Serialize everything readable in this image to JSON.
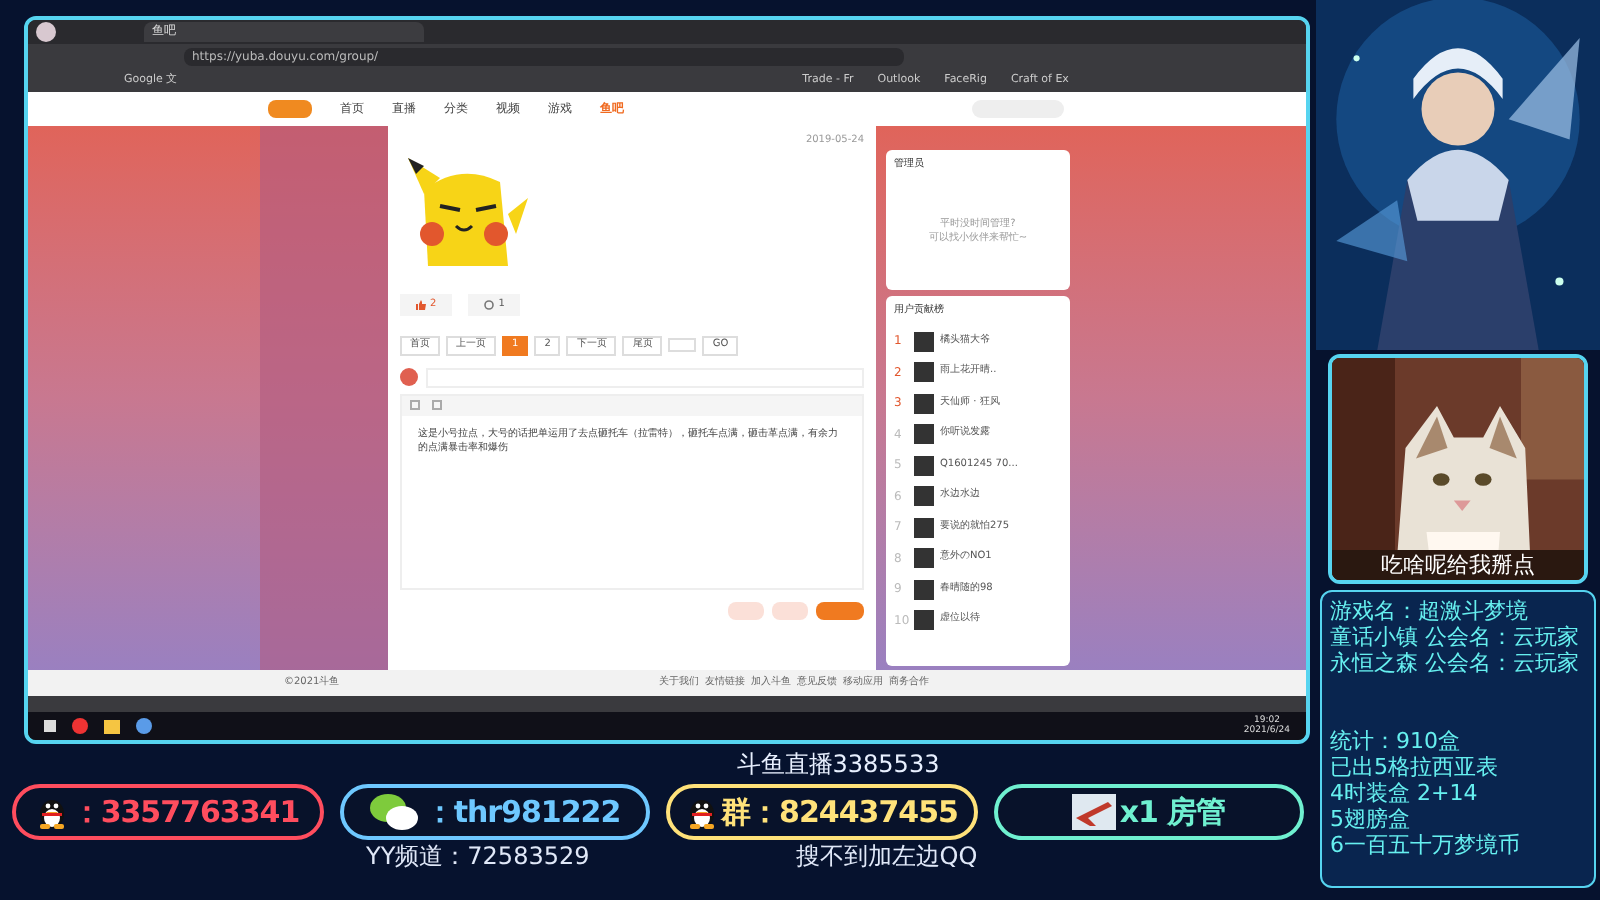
{
  "browser": {
    "tab_title": "鱼吧",
    "url": "https://yuba.douyu.com/group/",
    "bookmarks": [
      "Google 文",
      "Trade - Fr",
      "Outlook",
      "FaceRig",
      "Craft of Ex"
    ]
  },
  "site_nav": [
    {
      "label": "首页",
      "selected": false
    },
    {
      "label": "直播",
      "selected": false
    },
    {
      "label": "分类",
      "selected": false
    },
    {
      "label": "视频",
      "selected": false
    },
    {
      "label": "游戏",
      "selected": false
    },
    {
      "label": "鱼吧",
      "selected": true
    }
  ],
  "post": {
    "date": "2019-05-24",
    "likes": "2",
    "comments": "1"
  },
  "pagination": {
    "first": "首页",
    "prev": "上一页",
    "pages": [
      {
        "label": "1",
        "selected": true
      },
      {
        "label": "2",
        "selected": false
      }
    ],
    "next": "下一页",
    "last": "尾页",
    "go": "GO"
  },
  "reply": {
    "text": "这是小号拉点，大号的话把单运用了去点砸托车（拉雷特），砸托车点满，砸击革点满，有余力的点满暴击率和爆伤"
  },
  "admin_card": {
    "title": "管理员",
    "lines": [
      "平时没时间管理?",
      "可以找小伙伴来帮忙~"
    ]
  },
  "ranking": {
    "title": "用户贡献榜",
    "rows": [
      {
        "rank": "1",
        "name": "橘头猫大爷"
      },
      {
        "rank": "2",
        "name": "雨上花开晴.."
      },
      {
        "rank": "3",
        "name": "天仙师 · 狂风"
      },
      {
        "rank": "4",
        "name": "你听说发露"
      },
      {
        "rank": "5",
        "name": "Q1601245 70..."
      },
      {
        "rank": "6",
        "name": "水边水边"
      },
      {
        "rank": "7",
        "name": "要说的就怕275"
      },
      {
        "rank": "8",
        "name": "意外のNO1"
      },
      {
        "rank": "9",
        "name": "春晴随的98"
      },
      {
        "rank": "10",
        "name": "虚位以待"
      }
    ]
  },
  "footer": {
    "copyright": "©2021斗鱼",
    "links": [
      "关于我们",
      "友情链接",
      "加入斗鱼",
      "意见反馈",
      "移动应用",
      "商务合作"
    ]
  },
  "taskbar": {
    "time": "19:02",
    "date": "2021/6/24"
  },
  "cam": {
    "caption": "吃啥呢给我掰点"
  },
  "info": {
    "lines": [
      "游戏名：超激斗梦境",
      "童话小镇 公会名：云玩家",
      "永恒之森 公会名：云玩家"
    ],
    "stats": [
      "统计：910盒",
      "已出5格拉西亚表",
      "4时装盒 2+14",
      "5翅膀盒",
      "6一百五十万梦境币"
    ]
  },
  "overlay": {
    "title": "斗鱼直播3385533",
    "contacts": [
      {
        "kind": "qq",
        "text": "：3357763341",
        "color": "#ff4d5e"
      },
      {
        "kind": "wechat",
        "text": "：thr981222",
        "color": "#6ec8ff"
      },
      {
        "kind": "group",
        "text": "群：824437455",
        "color": "#ffe27a"
      },
      {
        "kind": "admin",
        "text": "x1 房管",
        "color": "#6ff0d0"
      }
    ],
    "captions": [
      "YY频道：72583529",
      "搜不到加左边QQ"
    ]
  }
}
